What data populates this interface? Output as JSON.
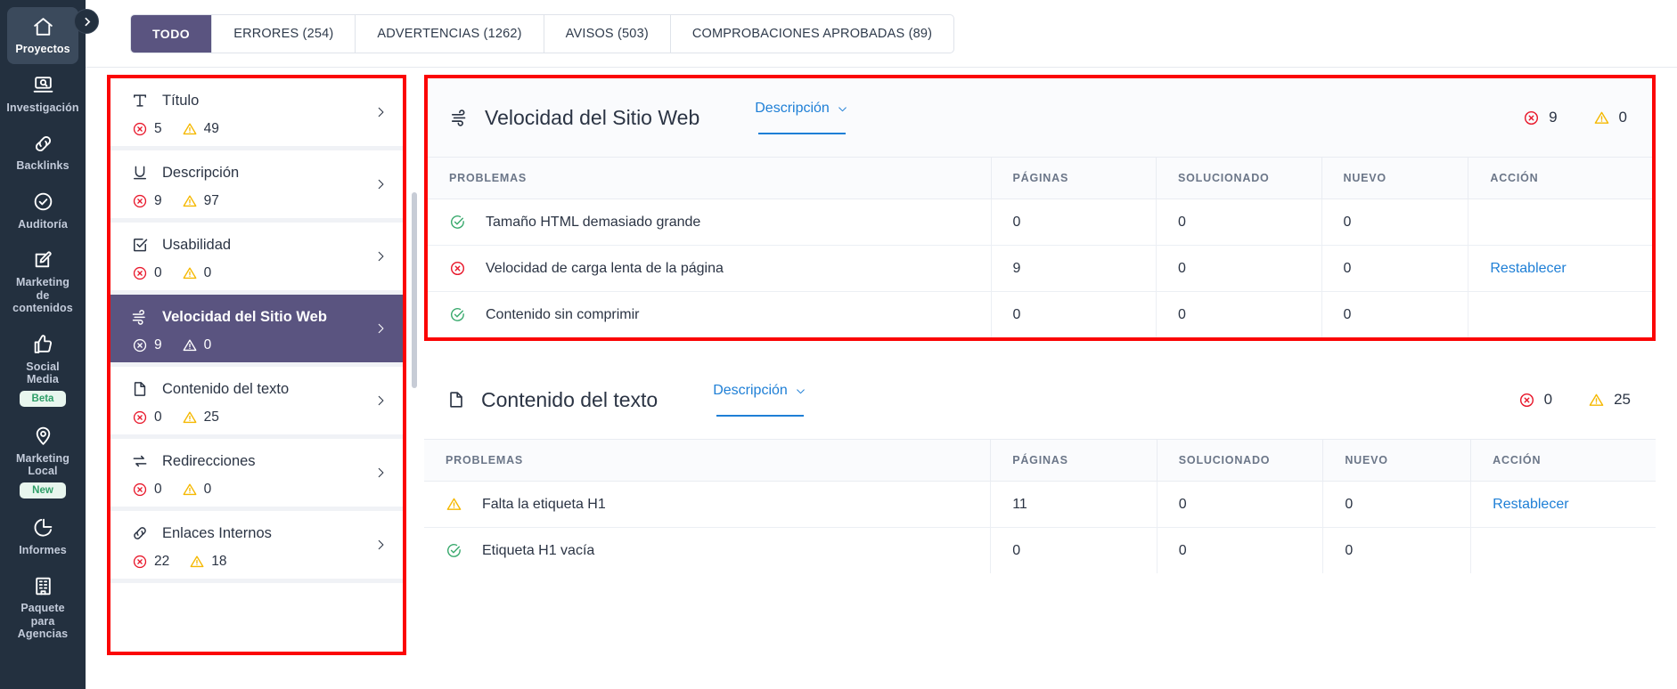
{
  "colors": {
    "accent_purple": "#5a5480",
    "link_blue": "#1e7fd6",
    "error_red": "#e8192c",
    "warning_yellow": "#f5b800",
    "ok_green": "#3aaa6e",
    "highlight_border": "#fb0505",
    "rail_bg": "#23303f"
  },
  "rail": {
    "collapse_icon": "chevron-right-icon",
    "items": [
      {
        "label": "Proyectos",
        "icon": "home-icon",
        "active": true,
        "badge": null
      },
      {
        "label": "Investigación",
        "icon": "laptop-search-icon",
        "active": false,
        "badge": null
      },
      {
        "label": "Backlinks",
        "icon": "link-chain-icon",
        "active": false,
        "badge": null
      },
      {
        "label": "Auditoría",
        "icon": "check-circle-icon",
        "active": false,
        "badge": null
      },
      {
        "label": "Marketing de contenidos",
        "icon": "pencil-square-icon",
        "active": false,
        "badge": null
      },
      {
        "label": "Social Media",
        "icon": "thumbs-up-icon",
        "active": false,
        "badge": "Beta"
      },
      {
        "label": "Marketing Local",
        "icon": "map-pin-icon",
        "active": false,
        "badge": "New"
      },
      {
        "label": "Informes",
        "icon": "pie-chart-icon",
        "active": false,
        "badge": null
      },
      {
        "label": "Paquete para Agencias",
        "icon": "building-icon",
        "active": false,
        "badge": null
      }
    ]
  },
  "tabs": [
    {
      "label": "TODO",
      "active": true
    },
    {
      "label": "ERRORES (254)",
      "active": false
    },
    {
      "label": "ADVERTENCIAS (1262)",
      "active": false
    },
    {
      "label": "AVISOS (503)",
      "active": false
    },
    {
      "label": "COMPROBACIONES APROBADAS (89)",
      "active": false
    }
  ],
  "categories": [
    {
      "name": "Título",
      "icon": "title-T-icon",
      "errors": "5",
      "warnings": "49",
      "selected": false
    },
    {
      "name": "Descripción",
      "icon": "underline-U-icon",
      "errors": "9",
      "warnings": "97",
      "selected": false
    },
    {
      "name": "Usabilidad",
      "icon": "checkbox-icon",
      "errors": "0",
      "warnings": "0",
      "selected": false
    },
    {
      "name": "Velocidad del Sitio Web",
      "icon": "wind-speed-icon",
      "errors": "9",
      "warnings": "0",
      "selected": true
    },
    {
      "name": "Contenido del texto",
      "icon": "document-icon",
      "errors": "0",
      "warnings": "25",
      "selected": false
    },
    {
      "name": "Redirecciones",
      "icon": "redirect-arrows-icon",
      "errors": "0",
      "warnings": "0",
      "selected": false
    },
    {
      "name": "Enlaces Internos",
      "icon": "link-chain-icon",
      "errors": "22",
      "warnings": "18",
      "selected": false
    }
  ],
  "table_headers": [
    "PROBLEMAS",
    "PÁGINAS",
    "SOLUCIONADO",
    "NUEVO",
    "ACCIÓN"
  ],
  "description_toggle": "Descripción",
  "cards": [
    {
      "title": "Velocidad del Sitio Web",
      "icon": "wind-speed-icon",
      "errors": "9",
      "warnings": "0",
      "highlighted": true,
      "rows": [
        {
          "status": "ok",
          "problem": "Tamaño HTML demasiado grande",
          "pages": "0",
          "solved": "0",
          "new": "0",
          "action": ""
        },
        {
          "status": "error",
          "problem": "Velocidad de carga lenta de la página",
          "pages": "9",
          "solved": "0",
          "new": "0",
          "action": "Restablecer"
        },
        {
          "status": "ok",
          "problem": "Contenido sin comprimir",
          "pages": "0",
          "solved": "0",
          "new": "0",
          "action": ""
        }
      ]
    },
    {
      "title": "Contenido del texto",
      "icon": "document-icon",
      "errors": "0",
      "warnings": "25",
      "highlighted": false,
      "rows": [
        {
          "status": "warning",
          "problem": "Falta la etiqueta H1",
          "pages": "11",
          "solved": "0",
          "new": "0",
          "action": "Restablecer"
        },
        {
          "status": "ok",
          "problem": "Etiqueta H1 vacía",
          "pages": "0",
          "solved": "0",
          "new": "0",
          "action": ""
        }
      ]
    }
  ]
}
